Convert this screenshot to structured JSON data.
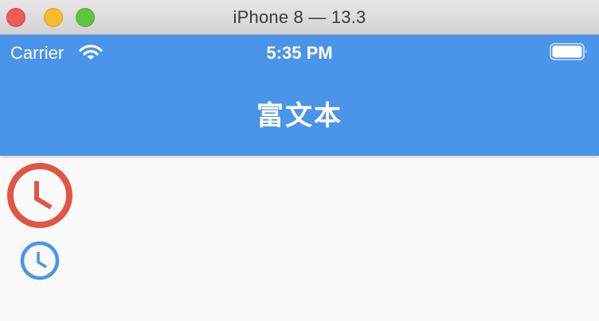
{
  "window": {
    "title": "iPhone 8 — 13.3"
  },
  "status_bar": {
    "carrier": "Carrier",
    "time": "5:35 PM",
    "wifi_icon": "wifi-icon",
    "battery_icon": "battery-icon"
  },
  "nav_bar": {
    "title": "富文本",
    "background": "#4a94ea"
  },
  "content": {
    "icons": [
      {
        "name": "clock-icon",
        "color": "#e05545"
      },
      {
        "name": "clock-icon",
        "color": "#4a94ea"
      }
    ]
  }
}
